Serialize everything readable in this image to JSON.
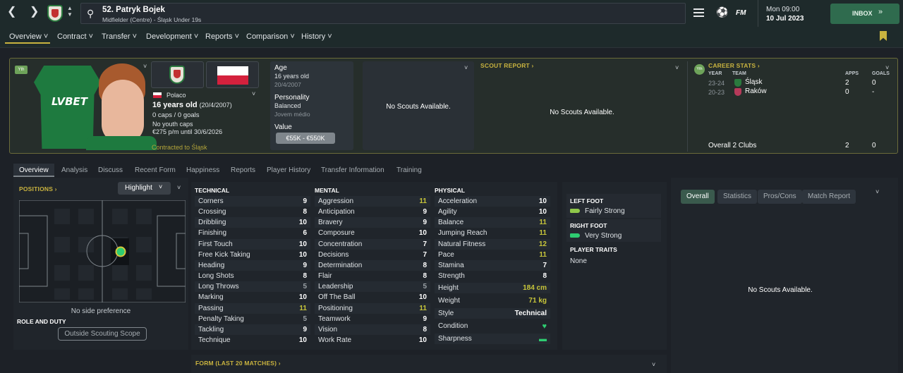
{
  "player": {
    "title": "52. Patryk Bojek",
    "subtitle": "Midfielder (Centre) - Śląsk Under 19s",
    "nationality": "Polaco",
    "age_line": "16 years old",
    "dob_paren": "(20/4/2007)",
    "caps": "0 caps / 0 goals",
    "youth_caps": "No youth caps",
    "wage": "€275 p/m until 30/6/2026",
    "contract": "Contracted to Śląsk",
    "badge": "Yth"
  },
  "topbar": {
    "date_top": "Mon 09:00",
    "date_bottom": "10 Jul 2023",
    "inbox": "INBOX",
    "fm": "FM"
  },
  "menu": [
    "Overview",
    "Contract",
    "Transfer",
    "Development",
    "Reports",
    "Comparison",
    "History"
  ],
  "age": {
    "label": "Age",
    "value": "16 years old",
    "dob": "20/4/2007"
  },
  "personality": {
    "label": "Personality",
    "value": "Balanced",
    "sub": "Jovem médio"
  },
  "value": {
    "label": "Value",
    "range": "€55K - €550K"
  },
  "scouts_small": "No Scouts Available.",
  "scout_report": {
    "title": "SCOUT REPORT",
    "text": "No Scouts Available."
  },
  "career": {
    "title": "CAREER STATS",
    "badge": "Yth",
    "headers": {
      "year": "YEAR",
      "team": "TEAM",
      "apps": "APPS",
      "goals": "GOALS"
    },
    "rows": [
      {
        "year": "23-24",
        "team": "Śląsk",
        "apps": "2",
        "goals": "0"
      },
      {
        "year": "20-23",
        "team": "Raków",
        "apps": "0",
        "goals": "-"
      }
    ],
    "overall": {
      "label": "Overall 2 Clubs",
      "apps": "2",
      "goals": "0"
    }
  },
  "subtabs": [
    "Overview",
    "Analysis",
    "Discuss",
    "Recent Form",
    "Happiness",
    "Reports",
    "Player History",
    "Transfer Information",
    "Training"
  ],
  "positions": {
    "title": "POSITIONS",
    "dropdown": "Highlight",
    "side_pref": "No side preference",
    "role_title": "ROLE AND DUTY",
    "role_button": "Outside Scouting Scope"
  },
  "technical": {
    "title": "TECHNICAL",
    "attrs": [
      {
        "name": "Corners",
        "value": "9"
      },
      {
        "name": "Crossing",
        "value": "8"
      },
      {
        "name": "Dribbling",
        "value": "10"
      },
      {
        "name": "Finishing",
        "value": "6"
      },
      {
        "name": "First Touch",
        "value": "10"
      },
      {
        "name": "Free Kick Taking",
        "value": "10"
      },
      {
        "name": "Heading",
        "value": "9"
      },
      {
        "name": "Long Shots",
        "value": "8"
      },
      {
        "name": "Long Throws",
        "value": "5"
      },
      {
        "name": "Marking",
        "value": "10"
      },
      {
        "name": "Passing",
        "value": "11"
      },
      {
        "name": "Penalty Taking",
        "value": "5"
      },
      {
        "name": "Tackling",
        "value": "9"
      },
      {
        "name": "Technique",
        "value": "10"
      }
    ]
  },
  "mental": {
    "title": "MENTAL",
    "attrs": [
      {
        "name": "Aggression",
        "value": "11"
      },
      {
        "name": "Anticipation",
        "value": "9"
      },
      {
        "name": "Bravery",
        "value": "9"
      },
      {
        "name": "Composure",
        "value": "10"
      },
      {
        "name": "Concentration",
        "value": "7"
      },
      {
        "name": "Decisions",
        "value": "7"
      },
      {
        "name": "Determination",
        "value": "8"
      },
      {
        "name": "Flair",
        "value": "8"
      },
      {
        "name": "Leadership",
        "value": "5"
      },
      {
        "name": "Off The Ball",
        "value": "10"
      },
      {
        "name": "Positioning",
        "value": "11"
      },
      {
        "name": "Teamwork",
        "value": "9"
      },
      {
        "name": "Vision",
        "value": "8"
      },
      {
        "name": "Work Rate",
        "value": "10"
      }
    ]
  },
  "physical": {
    "title": "PHYSICAL",
    "attrs": [
      {
        "name": "Acceleration",
        "value": "10"
      },
      {
        "name": "Agility",
        "value": "10"
      },
      {
        "name": "Balance",
        "value": "11"
      },
      {
        "name": "Jumping Reach",
        "value": "11"
      },
      {
        "name": "Natural Fitness",
        "value": "12"
      },
      {
        "name": "Pace",
        "value": "11"
      },
      {
        "name": "Stamina",
        "value": "7"
      },
      {
        "name": "Strength",
        "value": "8"
      }
    ],
    "extra": [
      {
        "name": "Height",
        "value": "184 cm"
      },
      {
        "name": "Weight",
        "value": "71 kg"
      },
      {
        "name": "Style",
        "value": "Technical"
      },
      {
        "name": "Condition",
        "value": ""
      },
      {
        "name": "Sharpness",
        "value": ""
      }
    ]
  },
  "feet": {
    "left_title": "LEFT FOOT",
    "left": "Fairly Strong",
    "right_title": "RIGHT FOOT",
    "right": "Very Strong",
    "traits_title": "PLAYER TRAITS",
    "traits": "None"
  },
  "right_panel": {
    "tabs": [
      "Overall",
      "Statistics",
      "Pros/Cons",
      "Match Report"
    ],
    "text": "No Scouts Available."
  },
  "form": {
    "title": "FORM (LAST 20 MATCHES)"
  },
  "colors": {
    "accent": "#c9b33f",
    "green": "#2ecc71",
    "attr_high": "#c8c63a",
    "inbox": "#2f6b4e"
  }
}
